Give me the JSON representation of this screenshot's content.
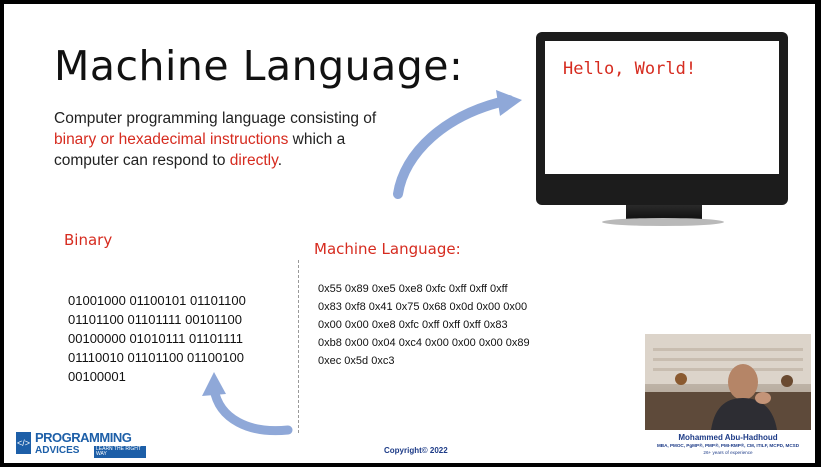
{
  "slide": {
    "title": "Machine Language:",
    "description": {
      "part1": "Computer programming language consisting of ",
      "highlight1": "binary or hexadecimal instructions",
      "part2": " which a computer can respond to ",
      "highlight2": "directly",
      "part3": "."
    },
    "monitor": {
      "text": "Hello, World!"
    },
    "binary": {
      "label": "Binary",
      "lines": [
        "01001000 01100101 01101100",
        "01101100 01101111 00101100",
        "00100000 01010111 01101111",
        "01110010 01101100 01100100",
        "00100001"
      ]
    },
    "machine_language": {
      "label": "Machine Language:",
      "lines": [
        "0x55 0x89 0xe5 0xe8 0xfc 0xff 0xff 0xff",
        "0x83 0xf8 0x41 0x75 0x68 0x0d 0x00 0x00",
        "0x00 0x00 0xe8 0xfc 0xff 0xff 0xff 0x83",
        "0xb8 0x00 0x04 0xc4 0x00 0x00 0x00 0x89",
        "0xec 0x5d 0xc3"
      ]
    },
    "copyright": "Copyright© 2022"
  },
  "branding": {
    "logo_top": "PROGRAMMING",
    "logo_bottom": "ADVICES",
    "logo_tagline": "LEARN THE RIGHT WAY"
  },
  "presenter": {
    "name": "Mohammed Abu-Hadhoud",
    "credentials": "MBA, PMOC, PgMP®, PMP®, PMI-RMP®, CM, ITILF, MCPD, MCSD",
    "experience": "26+ years of experience"
  },
  "colors": {
    "accent_red": "#d62b1f",
    "arrow_blue": "#8fa8d8",
    "brand_blue": "#1d5fa8"
  }
}
